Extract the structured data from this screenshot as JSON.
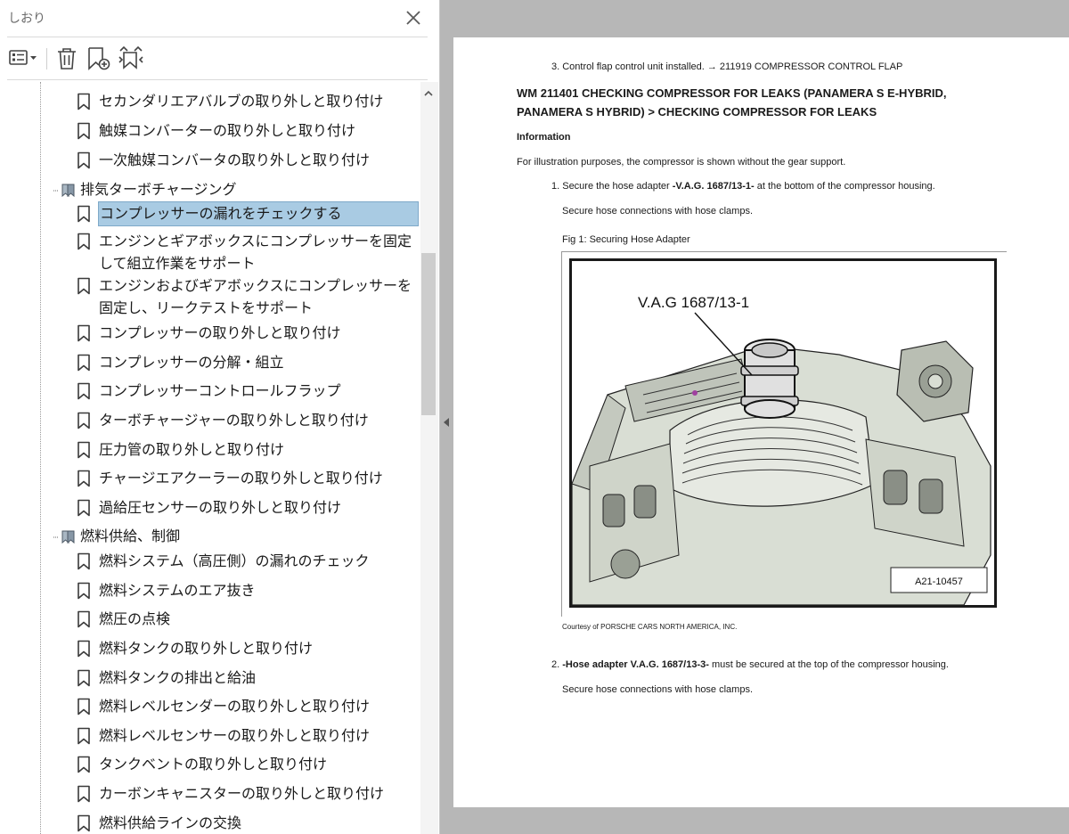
{
  "panel": {
    "title": "しおり",
    "toolbar": {
      "options_icon": "list-options-icon",
      "delete_icon": "trash-icon",
      "new_icon": "add-bookmark-icon",
      "expand_icon": "expand-bookmark-icon"
    }
  },
  "bookmarks": [
    {
      "type": "bookmark",
      "label": "セカンダリエアバルブの取り外しと取り付け"
    },
    {
      "type": "bookmark",
      "label": "触媒コンバーターの取り外しと取り付け"
    },
    {
      "type": "bookmark",
      "label": "一次触媒コンバータの取り外しと取り付け"
    },
    {
      "type": "folder",
      "label": "排気ターボチャージング"
    },
    {
      "type": "bookmark",
      "label": "コンプレッサーの漏れをチェックする",
      "selected": true
    },
    {
      "type": "bookmark",
      "label": "エンジンとギアボックスにコンプレッサーを固定して組立作業をサポート"
    },
    {
      "type": "bookmark",
      "label": "エンジンおよびギアボックスにコンプレッサーを固定し、リークテストをサポート"
    },
    {
      "type": "bookmark",
      "label": "コンプレッサーの取り外しと取り付け"
    },
    {
      "type": "bookmark",
      "label": "コンプレッサーの分解・組立"
    },
    {
      "type": "bookmark",
      "label": "コンプレッサーコントロールフラップ"
    },
    {
      "type": "bookmark",
      "label": "ターボチャージャーの取り外しと取り付け"
    },
    {
      "type": "bookmark",
      "label": "圧力管の取り外しと取り付け"
    },
    {
      "type": "bookmark",
      "label": "チャージエアクーラーの取り外しと取り付け"
    },
    {
      "type": "bookmark",
      "label": "過給圧センサーの取り外しと取り付け"
    },
    {
      "type": "folder",
      "label": "燃料供給、制御"
    },
    {
      "type": "bookmark",
      "label": "燃料システム（高圧側）の漏れのチェック"
    },
    {
      "type": "bookmark",
      "label": "燃料システムのエア抜き"
    },
    {
      "type": "bookmark",
      "label": "燃圧の点検"
    },
    {
      "type": "bookmark",
      "label": "燃料タンクの取り外しと取り付け"
    },
    {
      "type": "bookmark",
      "label": "燃料タンクの排出と給油"
    },
    {
      "type": "bookmark",
      "label": "燃料レベルセンダーの取り外しと取り付け"
    },
    {
      "type": "bookmark",
      "label": "燃料レベルセンサーの取り外しと取り付け"
    },
    {
      "type": "bookmark",
      "label": "タンクベントの取り外しと取り付け"
    },
    {
      "type": "bookmark",
      "label": "カーボンキャニスターの取り外しと取り付け"
    },
    {
      "type": "bookmark",
      "label": "燃料供給ラインの交換"
    }
  ],
  "document": {
    "step3": "3. Control flap control unit installed. → 211919 COMPRESSOR CONTROL FLAP",
    "heading_line1": "WM 211401 CHECKING COMPRESSOR FOR LEAKS (PANAMERA S E-HYBRID,",
    "heading_line2": "PANAMERA S HYBRID) > CHECKING COMPRESSOR FOR LEAKS",
    "info_title": "Information",
    "info_text": "For illustration purposes, the compressor is shown without the gear support.",
    "step1_pre": "1. Secure the hose adapter ",
    "step1_bold": "-V.A.G. 1687/13-1-",
    "step1_post": "  at the bottom of the compressor housing.",
    "step1_sub": "Secure hose connections with hose clamps.",
    "fig_caption": "Fig 1: Securing Hose Adapter",
    "fig_callout": "V.A.G 1687/13-1",
    "fig_ref": "A21-10457",
    "courtesy": "Courtesy of PORSCHE CARS NORTH AMERICA, INC.",
    "step2_pre": "2. ",
    "step2_bold": "-Hose adapter V.A.G. 1687/13-3-",
    "step2_post": "  must be secured at the top of the compressor housing.",
    "step2_sub": "Secure hose connections with hose clamps."
  },
  "colors": {
    "selection": "#a9cbe3",
    "gutter": "#b7b7b7"
  }
}
